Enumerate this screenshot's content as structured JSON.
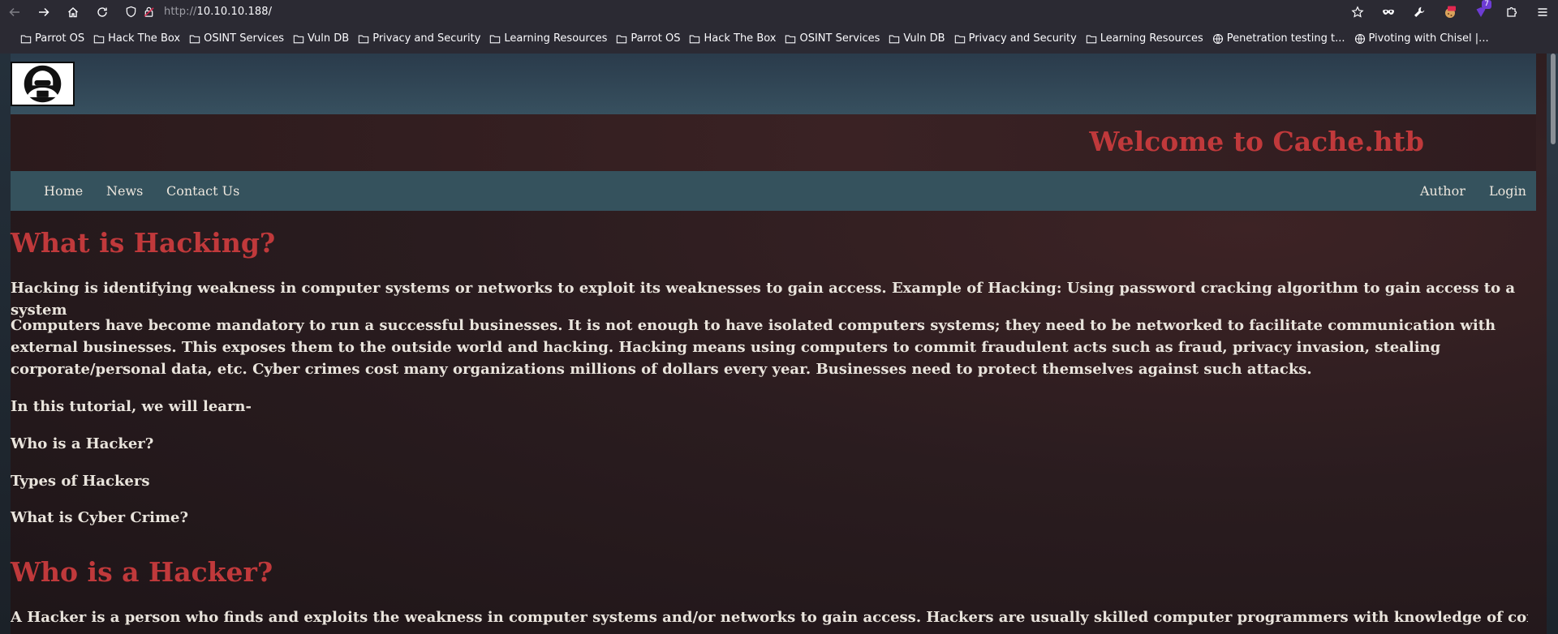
{
  "browser": {
    "url_protocol": "http://",
    "url_host": "10.10.10.188/",
    "extension_badge": "7"
  },
  "bookmarks": [
    {
      "label": "Parrot OS",
      "icon": "folder-icon"
    },
    {
      "label": "Hack The Box",
      "icon": "folder-icon"
    },
    {
      "label": "OSINT Services",
      "icon": "folder-icon"
    },
    {
      "label": "Vuln DB",
      "icon": "folder-icon"
    },
    {
      "label": "Privacy and Security",
      "icon": "folder-icon"
    },
    {
      "label": "Learning Resources",
      "icon": "folder-icon"
    },
    {
      "label": "Parrot OS",
      "icon": "folder-icon"
    },
    {
      "label": "Hack The Box",
      "icon": "folder-icon"
    },
    {
      "label": "OSINT Services",
      "icon": "folder-icon"
    },
    {
      "label": "Vuln DB",
      "icon": "folder-icon"
    },
    {
      "label": "Privacy and Security",
      "icon": "folder-icon"
    },
    {
      "label": "Learning Resources",
      "icon": "folder-icon"
    },
    {
      "label": "Penetration testing t...",
      "icon": "globe-icon"
    },
    {
      "label": "Pivoting with Chisel |...",
      "icon": "globe-icon"
    }
  ],
  "site": {
    "title": "Welcome to Cache.htb",
    "nav_left": [
      "Home",
      "News",
      "Contact Us"
    ],
    "nav_right": [
      "Author",
      "Login"
    ],
    "colors": {
      "accent": "#c0393b",
      "nav": "#35525d"
    }
  },
  "content": {
    "h1": "What is Hacking?",
    "p1": "Hacking is identifying weakness in computer systems or networks to exploit its weaknesses to gain access. Example of Hacking: Using password cracking algorithm to gain access to a system",
    "p2": "Computers have become mandatory to run a successful businesses. It is not enough to have isolated computers systems; they need to be networked to facilitate communication with external businesses. This exposes them to the outside world and hacking. Hacking means using computers to commit fraudulent acts such as fraud, privacy invasion, stealing corporate/personal data, etc. Cyber crimes cost many organizations millions of dollars every year. Businesses need to protect themselves against such attacks.",
    "p3": "In this tutorial, we will learn-",
    "p4": "Who is a Hacker?",
    "p5": "Types of Hackers",
    "p6": "What is Cyber Crime?",
    "h2": "Who is a Hacker?",
    "p7": "A Hacker is a person who finds and exploits the weakness in computer systems and/or networks to gain access. Hackers are usually skilled computer programmers with knowledge of computer"
  }
}
